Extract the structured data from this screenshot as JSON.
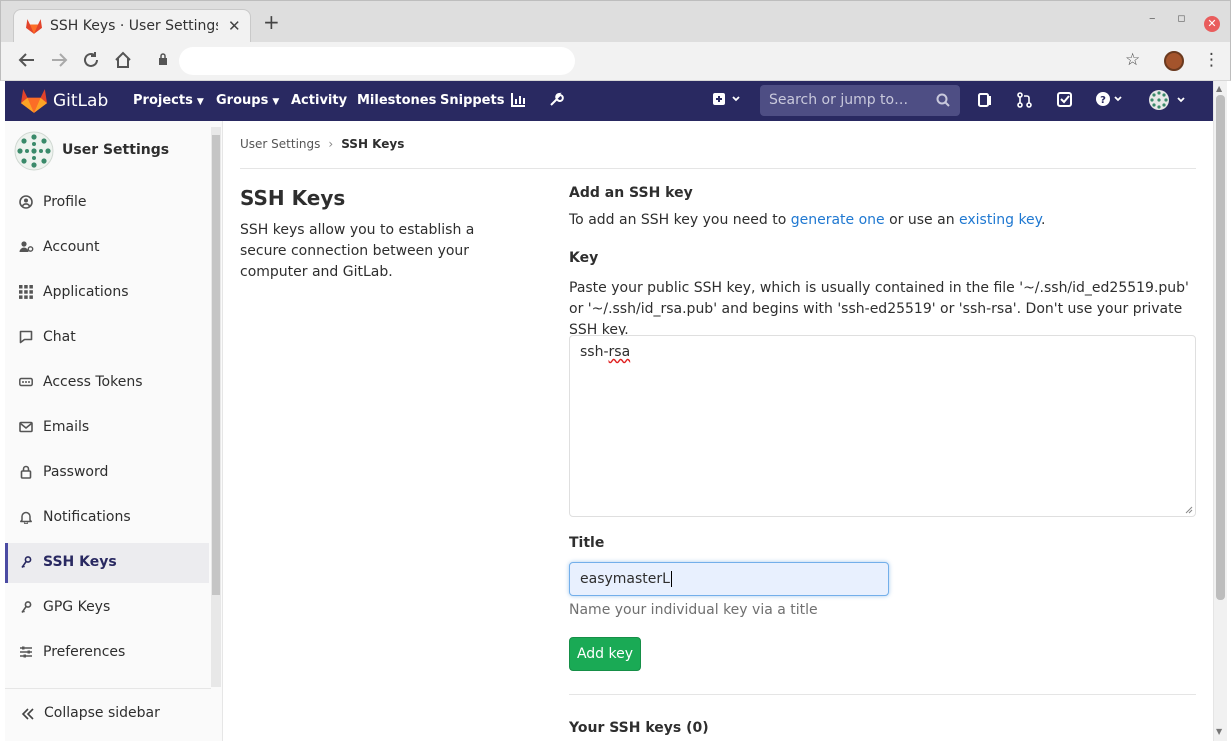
{
  "browser": {
    "tab_title": "SSH Keys · User Settings · G",
    "new_tab": "+",
    "close_tab": "✕",
    "window_minimize": "–",
    "window_maximize": "▫",
    "window_close": "✕"
  },
  "gitlab": {
    "brand": "GitLab",
    "menu": {
      "projects": "Projects",
      "groups": "Groups",
      "activity": "Activity",
      "milestones": "Milestones",
      "snippets": "Snippets"
    },
    "search_placeholder": "Search or jump to…",
    "accent": "#292961",
    "success": "#1aaa55",
    "link": "#1f78d1"
  },
  "sidebar": {
    "title": "User Settings",
    "items": [
      {
        "label": "Profile",
        "icon": "profile-icon"
      },
      {
        "label": "Account",
        "icon": "account-icon"
      },
      {
        "label": "Applications",
        "icon": "applications-icon"
      },
      {
        "label": "Chat",
        "icon": "chat-icon"
      },
      {
        "label": "Access Tokens",
        "icon": "access-tokens-icon"
      },
      {
        "label": "Emails",
        "icon": "mail-icon"
      },
      {
        "label": "Password",
        "icon": "lock-icon"
      },
      {
        "label": "Notifications",
        "icon": "bell-icon"
      },
      {
        "label": "SSH Keys",
        "icon": "key-icon",
        "active": true
      },
      {
        "label": "GPG Keys",
        "icon": "key-icon"
      },
      {
        "label": "Preferences",
        "icon": "preferences-icon"
      }
    ],
    "collapse": "Collapse sidebar"
  },
  "breadcrumb": {
    "parent": "User Settings",
    "sep": "›",
    "current": "SSH Keys"
  },
  "main": {
    "heading": "SSH Keys",
    "description": "SSH keys allow you to establish a secure connection between your computer and GitLab.",
    "add_title": "Add an SSH key",
    "add_text_prefix": "To add an SSH key you need to ",
    "generate_link": "generate one",
    "add_text_middle": " or use an ",
    "existing_link": "existing key",
    "add_text_suffix": ".",
    "key_label": "Key",
    "key_help": "Paste your public SSH key, which is usually contained in the file '~/.ssh/id_ed25519.pub' or '~/.ssh/id_rsa.pub' and begins with 'ssh-ed25519' or 'ssh-rsa'. Don't use your private SSH key.",
    "key_value_a": "ssh-",
    "key_value_b": "rsa",
    "title_label": "Title",
    "title_value": "easymasterL",
    "title_help": "Name your individual key via a title",
    "add_button": "Add key",
    "your_keys": "Your SSH keys (0)"
  }
}
